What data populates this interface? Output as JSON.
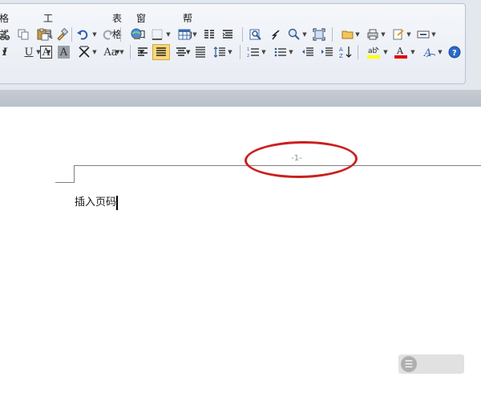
{
  "menubar": {
    "items": [
      {
        "label": "格式",
        "display": "格式"
      },
      {
        "label": "工具"
      },
      {
        "label": "表格"
      },
      {
        "label": "窗口"
      },
      {
        "label": "帮助"
      }
    ]
  },
  "toolbar_row1": {
    "icons": [
      "cut-icon",
      "copy-icon",
      "paste-icon",
      "format-painter-icon",
      "undo-icon",
      "redo-icon",
      "hyperlink-icon",
      "border-icon",
      "table-icon",
      "columns-icon",
      "paragraph-mark-icon",
      "find-icon",
      "navigation-icon",
      "zoom-icon",
      "fullscreen-icon",
      "open-folder-icon",
      "print-icon",
      "document-map-icon",
      "textbox-icon"
    ]
  },
  "toolbar_row2": {
    "labels": {
      "italic": "I",
      "underline": "U",
      "char_border": "A",
      "char_shading": "A",
      "change_case": "Aa"
    },
    "icons": [
      "align-left-icon",
      "justify-icon",
      "align-center-icon",
      "distributed-icon",
      "line-spacing-icon",
      "numbering-icon",
      "bullets-icon",
      "decrease-indent-icon",
      "increase-indent-icon",
      "sort-icon",
      "highlight-icon",
      "font-color-icon",
      "text-effect-icon",
      "help-icon"
    ],
    "colors": {
      "highlight": "#ffff00",
      "font_color": "#e00000"
    }
  },
  "document": {
    "header_page_number": "-1-",
    "body_text": "插入页码"
  },
  "colors": {
    "annotation_ellipse": "#cc1f1f",
    "header_line": "#808080"
  }
}
